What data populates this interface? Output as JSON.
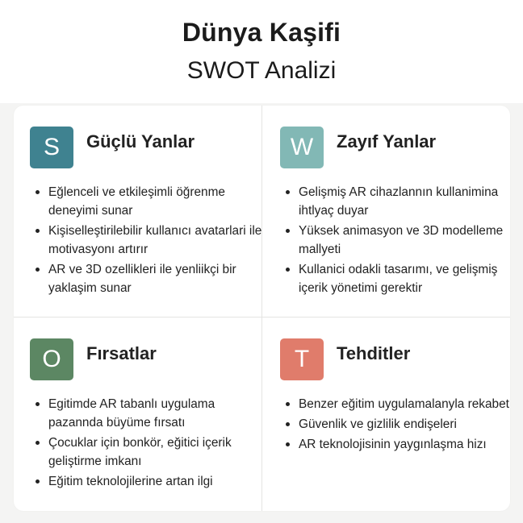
{
  "header": {
    "title": "Dünya Kaşifi",
    "subtitle": "SWOT Analizi"
  },
  "quadrants": [
    {
      "letter": "S",
      "title": "Güçlü Yanlar",
      "color": "#3f8290",
      "items": [
        "Eğlenceli ve etkileşimli öğrenme deneyimi sunar",
        "Kişiselleştirilebilir kullanıcı avatarlari ile motivasyonı artırır",
        "AR ve 3D ozellikleri ile yenliikçi bir yaklaşim sunar"
      ]
    },
    {
      "letter": "W",
      "title": "Zayıf Yanlar",
      "color": "#82b8b5",
      "items": [
        "Gelişmiş AR cihazlannın kullanimina ihtlyaç duyar",
        "Yüksek animasyon ve 3D modelleme mallyeti",
        "Kullanici odakli tasarımı, ve gelişmiş içerik yönetimi gerektir"
      ]
    },
    {
      "letter": "O",
      "title": "Fırsatlar",
      "color": "#5c8763",
      "items": [
        "Egitimde AR tabanlı uygulama pazannda büyüme fırsatı",
        "Çocuklar için bonkör, eğitici içerik geliştirme imkanı",
        "Eğitim teknolojilerine artan ilgi"
      ]
    },
    {
      "letter": "T",
      "title": "Tehditler",
      "color": "#e07c6b",
      "items": [
        "Benzer eğitim uygulamalanyla rekabet",
        "Güvenlik ve gizlilik endişeleri",
        "AR teknolojisinin yaygınlaşma hizı"
      ]
    }
  ]
}
